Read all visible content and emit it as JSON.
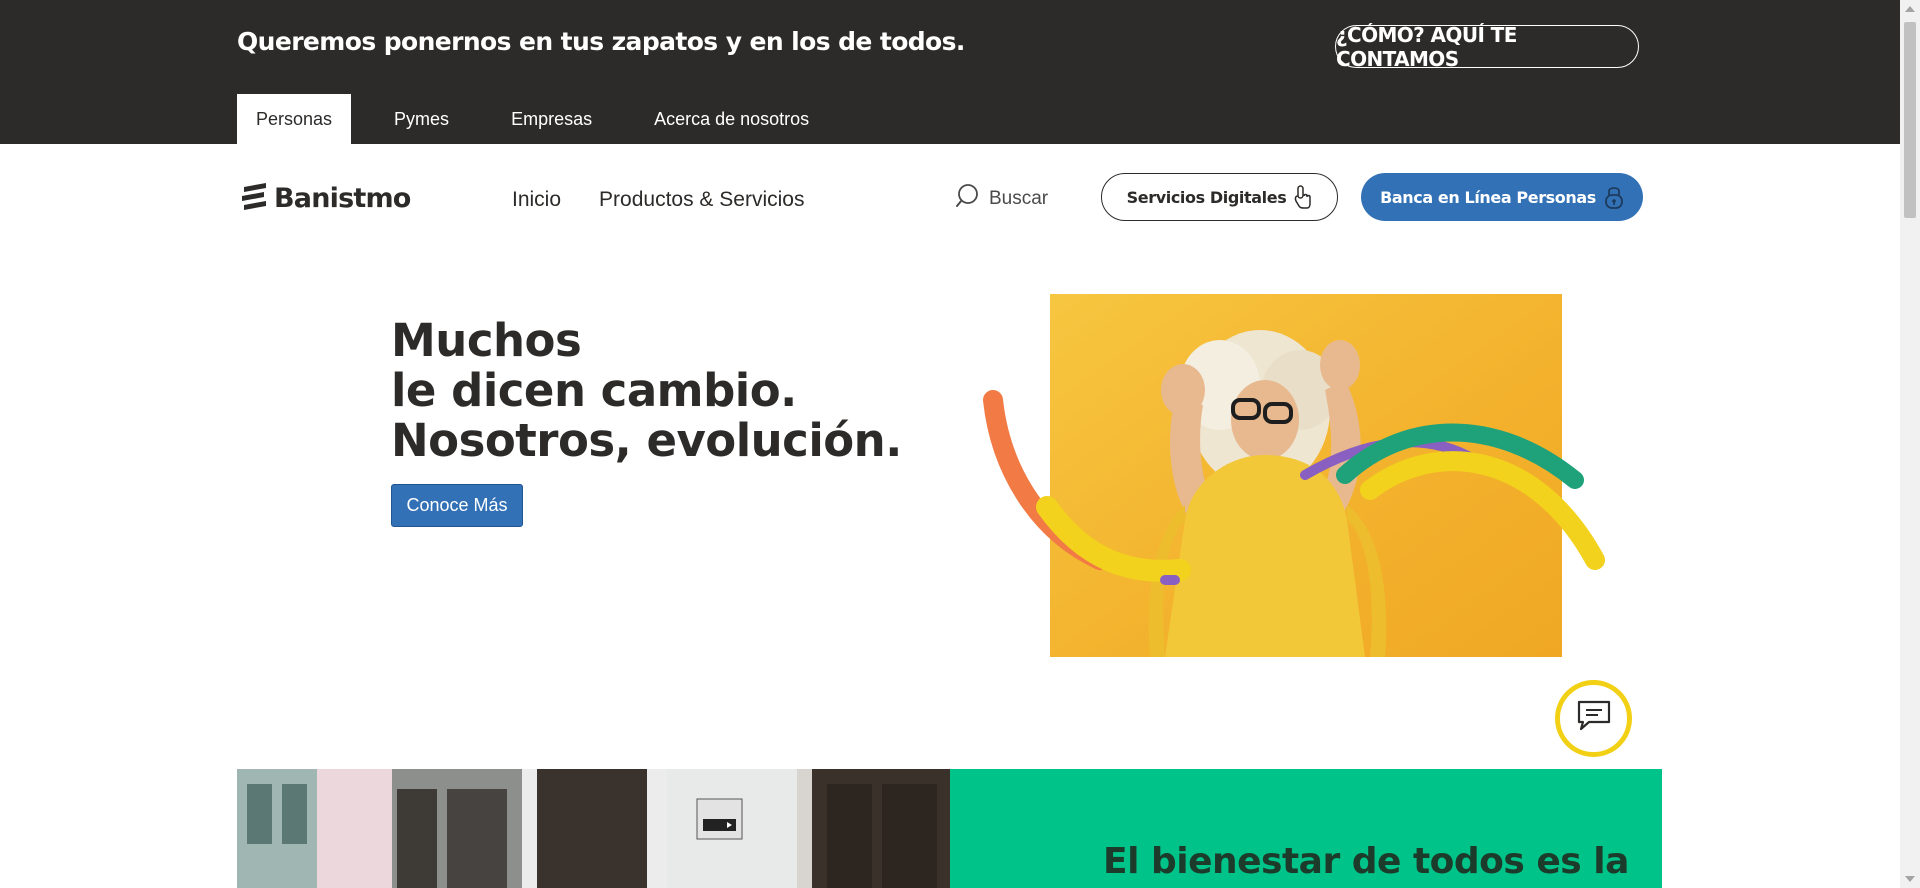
{
  "topbar": {
    "tagline": "Queremos ponernos en tus zapatos y en los de todos.",
    "como_button": "¿CÓMO? AQUÍ TE CONTAMOS",
    "segments": [
      "Personas",
      "Pymes",
      "Empresas",
      "Acerca de nosotros"
    ],
    "active_segment": "Personas"
  },
  "nav": {
    "logo_text": "Banistmo",
    "items": [
      "Inicio",
      "Productos & Servicios"
    ],
    "search_label": "Buscar",
    "digital_services_button": "Servicios Digitales",
    "online_banking_button": "Banca en Línea Personas"
  },
  "hero": {
    "title_lines": [
      "Muchos",
      "le dicen cambio.",
      "Nosotros, evolución."
    ],
    "cta_label": "Conoce Más"
  },
  "lower": {
    "green_title": "El bienestar de todos es la"
  },
  "colors": {
    "dark_bar": "#2d2b29",
    "primary_blue": "#3271b6",
    "green": "#00c389",
    "yellow": "#f2d015",
    "hero_bg": "#f3b12c"
  },
  "icons": {
    "search": "search-icon",
    "hand_pointer": "hand-pointer-icon",
    "lock": "lock-icon",
    "chat": "chat-icon"
  }
}
